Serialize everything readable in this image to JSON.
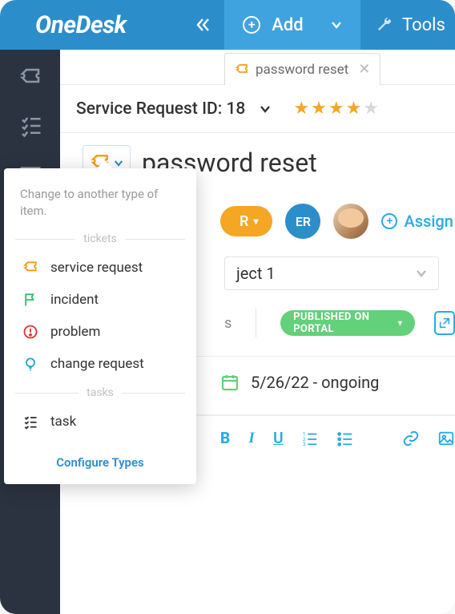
{
  "app": {
    "name": "OneDesk"
  },
  "topbar": {
    "add_label": "Add",
    "tools_label": "Tools"
  },
  "tab": {
    "title": "password reset"
  },
  "id_row": {
    "label": "Service Request ID: 18",
    "stars": 4,
    "stars_max": 5
  },
  "title": "password reset",
  "assign": {
    "r_label": "R",
    "er_label": "ER",
    "assign_label": "Assign"
  },
  "project": {
    "selected": "ject 1"
  },
  "status": {
    "published_label": "PUBLISHED ON PORTAL"
  },
  "date": {
    "text": "5/26/22 - ongoing"
  },
  "popup": {
    "hint": "Change to another type of item.",
    "section_tickets": "tickets",
    "section_tasks": "tasks",
    "items_tickets": [
      {
        "key": "service_request",
        "label": "service request",
        "icon": "ticket",
        "color": "#f59e0b"
      },
      {
        "key": "incident",
        "label": "incident",
        "icon": "flag",
        "color": "#27c06a"
      },
      {
        "key": "problem",
        "label": "problem",
        "icon": "alert",
        "color": "#e53535"
      },
      {
        "key": "change_request",
        "label": "change request",
        "icon": "bulb",
        "color": "#1ea7d6"
      }
    ],
    "items_tasks": [
      {
        "key": "task",
        "label": "task",
        "icon": "list",
        "color": "#333"
      }
    ],
    "configure_label": "Configure Types"
  },
  "editor": {
    "b": "B",
    "i": "I",
    "u": "U"
  }
}
